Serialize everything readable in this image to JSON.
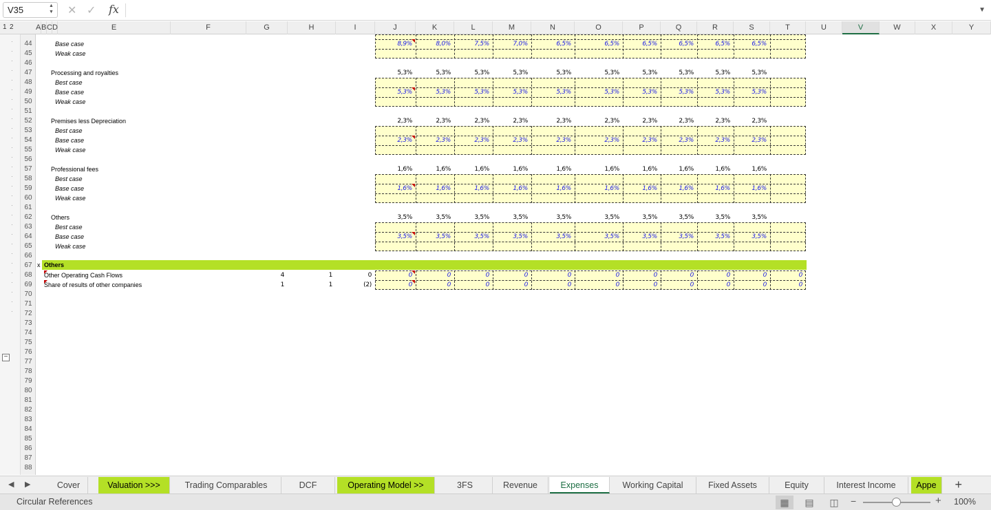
{
  "formula_bar": {
    "cell_reference": "V35",
    "cancel_icon": "cancel-x-icon",
    "confirm_icon": "checkmark-icon",
    "fx_label": "fx",
    "formula": ""
  },
  "outline_levels": [
    "1",
    "2"
  ],
  "columns": [
    "A",
    "B",
    "C",
    "D",
    "E",
    "F",
    "G",
    "H",
    "I",
    "J",
    "K",
    "L",
    "M",
    "N",
    "O",
    "P",
    "Q",
    "R",
    "S",
    "T",
    "U",
    "V",
    "W",
    "X",
    "Y"
  ],
  "selected_column": "V",
  "rows": [
    "44",
    "45",
    "46",
    "47",
    "48",
    "49",
    "50",
    "51",
    "52",
    "53",
    "54",
    "55",
    "56",
    "57",
    "58",
    "59",
    "60",
    "61",
    "62",
    "63",
    "64",
    "65",
    "66",
    "67",
    "68",
    "69",
    "70",
    "71",
    "72",
    "73",
    "74",
    "75",
    "76",
    "77",
    "78",
    "79",
    "80",
    "81",
    "82",
    "83",
    "84",
    "85",
    "86",
    "87",
    "88"
  ],
  "labels": {
    "best_case": "Best case",
    "base_case": "Base case",
    "weak_case": "Weak case"
  },
  "sections": [
    {
      "title": "",
      "summary": null,
      "base": [
        "8,9%",
        "8,0%",
        "7,5%",
        "7,0%",
        "6,5%",
        "6,5%",
        "6,5%",
        "6,5%",
        "6,5%",
        "6,5%"
      ]
    },
    {
      "title": "Processing and royalties",
      "summary": [
        "5,3%",
        "5,3%",
        "5,3%",
        "5,3%",
        "5,3%",
        "5,3%",
        "5,3%",
        "5,3%",
        "5,3%",
        "5,3%"
      ],
      "base": [
        "5,3%",
        "5,3%",
        "5,3%",
        "5,3%",
        "5,3%",
        "5,3%",
        "5,3%",
        "5,3%",
        "5,3%",
        "5,3%"
      ]
    },
    {
      "title": "Premises less Depreciation",
      "summary": [
        "2,3%",
        "2,3%",
        "2,3%",
        "2,3%",
        "2,3%",
        "2,3%",
        "2,3%",
        "2,3%",
        "2,3%",
        "2,3%"
      ],
      "base": [
        "2,3%",
        "2,3%",
        "2,3%",
        "2,3%",
        "2,3%",
        "2,3%",
        "2,3%",
        "2,3%",
        "2,3%",
        "2,3%"
      ]
    },
    {
      "title": "Professional fees",
      "summary": [
        "1,6%",
        "1,6%",
        "1,6%",
        "1,6%",
        "1,6%",
        "1,6%",
        "1,6%",
        "1,6%",
        "1,6%",
        "1,6%"
      ],
      "base": [
        "1,6%",
        "1,6%",
        "1,6%",
        "1,6%",
        "1,6%",
        "1,6%",
        "1,6%",
        "1,6%",
        "1,6%",
        "1,6%"
      ]
    },
    {
      "title": "Others",
      "summary": [
        "3,5%",
        "3,5%",
        "3,5%",
        "3,5%",
        "3,5%",
        "3,5%",
        "3,5%",
        "3,5%",
        "3,5%",
        "3,5%"
      ],
      "base": [
        "3,5%",
        "3,5%",
        "3,5%",
        "3,5%",
        "3,5%",
        "3,5%",
        "3,5%",
        "3,5%",
        "3,5%",
        "3,5%"
      ]
    }
  ],
  "others_block": {
    "marker": "x",
    "title": "Others",
    "rows": [
      {
        "label": "Other Operating Cash Flows",
        "hist": [
          "4",
          "1",
          "0"
        ],
        "proj": [
          "0",
          "0",
          "0",
          "0",
          "0",
          "0",
          "0",
          "0",
          "0",
          "0",
          "0"
        ]
      },
      {
        "label": "Share of results of other companies",
        "hist": [
          "1",
          "1",
          "(2)"
        ],
        "proj": [
          "0",
          "0",
          "0",
          "0",
          "0",
          "0",
          "0",
          "0",
          "0",
          "0",
          "0"
        ]
      }
    ]
  },
  "sheet_tabs": [
    {
      "label": "Cover",
      "style": "normal"
    },
    {
      "label": "Valuation >>>",
      "style": "green"
    },
    {
      "label": "Trading Comparables",
      "style": "normal"
    },
    {
      "label": "DCF",
      "style": "normal"
    },
    {
      "label": "Operating Model >>",
      "style": "green"
    },
    {
      "label": "3FS",
      "style": "normal"
    },
    {
      "label": "Revenue",
      "style": "normal"
    },
    {
      "label": "Expenses",
      "style": "active"
    },
    {
      "label": "Working Capital",
      "style": "normal"
    },
    {
      "label": "Fixed Assets",
      "style": "normal"
    },
    {
      "label": "Equity",
      "style": "normal"
    },
    {
      "label": "Interest Income",
      "style": "normal"
    },
    {
      "label": "Appe",
      "style": "green"
    }
  ],
  "add_sheet_label": "+",
  "status": {
    "message": "Circular References",
    "zoom": "100%",
    "zoom_fraction": 0.5
  },
  "colors": {
    "accent_green": "#b4e026",
    "active_tab_green": "#1d6e43",
    "input_blue": "#1a1ae6",
    "input_fill": "#ffffcc"
  }
}
